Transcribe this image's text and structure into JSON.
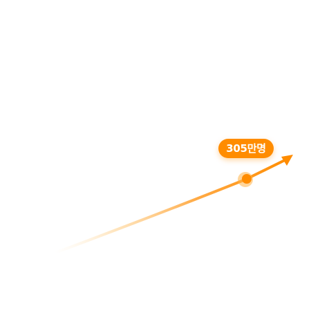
{
  "badge": {
    "label": "305만명"
  },
  "colors": {
    "accent": "#FF8C00",
    "accent_light": "#FFB347",
    "fade": "#FFE7C2",
    "background": "#FFFFFF"
  },
  "icons": {
    "arrow_head": "arrow-head-icon",
    "marker": "data-point-marker-icon"
  }
}
